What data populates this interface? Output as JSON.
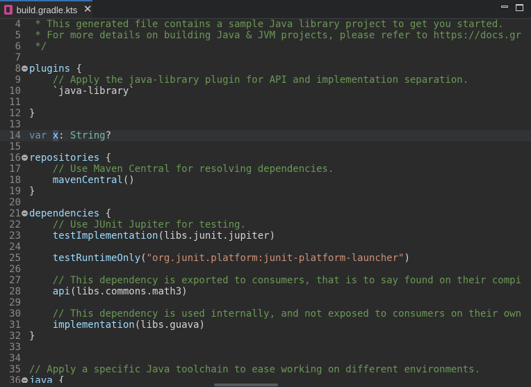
{
  "tab": {
    "title": "build.gradle.kts",
    "close_glyph": "✕"
  },
  "icons": {
    "file": "kotlin-file-icon",
    "close": "close-icon",
    "minimize": "minimize-icon",
    "maximize": "maximize-icon",
    "fold": "fold-collapse-icon"
  },
  "colors": {
    "background": "#2b2b2b",
    "comment": "#6a9955",
    "keyword": "#6897bb",
    "string": "#ce9178",
    "tab_accent": "#3a6fb0"
  },
  "current_line": 14,
  "lines": [
    {
      "n": 4,
      "fold": false,
      "tokens": [
        {
          "t": " * This generated file contains a sample Java library project to get you started.",
          "c": "comment"
        }
      ]
    },
    {
      "n": 5,
      "fold": false,
      "tokens": [
        {
          "t": " * For more details on building Java & JVM projects, please refer to https://docs.gr",
          "c": "comment"
        }
      ]
    },
    {
      "n": 6,
      "fold": false,
      "tokens": [
        {
          "t": " */",
          "c": "comment"
        }
      ]
    },
    {
      "n": 7,
      "fold": false,
      "tokens": []
    },
    {
      "n": 8,
      "fold": true,
      "tokens": [
        {
          "t": "plugins",
          "c": "fn"
        },
        {
          "t": " {",
          "c": "plain"
        }
      ]
    },
    {
      "n": 9,
      "fold": false,
      "tokens": [
        {
          "t": "    // Apply the java-library plugin for API and implementation separation.",
          "c": "comment"
        }
      ]
    },
    {
      "n": 10,
      "fold": false,
      "tokens": [
        {
          "t": "    `java-library`",
          "c": "plain"
        }
      ]
    },
    {
      "n": 11,
      "fold": false,
      "tokens": []
    },
    {
      "n": 12,
      "fold": false,
      "tokens": [
        {
          "t": "}",
          "c": "plain"
        }
      ]
    },
    {
      "n": 13,
      "fold": false,
      "tokens": []
    },
    {
      "n": 14,
      "fold": false,
      "tokens": [
        {
          "t": "var",
          "c": "kw"
        },
        {
          "t": " ",
          "c": "plain"
        },
        {
          "t": "x",
          "c": "var"
        },
        {
          "t": ": ",
          "c": "plain"
        },
        {
          "t": "String",
          "c": "type"
        },
        {
          "t": "?",
          "c": "plain"
        }
      ]
    },
    {
      "n": 15,
      "fold": false,
      "tokens": []
    },
    {
      "n": 16,
      "fold": true,
      "tokens": [
        {
          "t": "repositories",
          "c": "fn"
        },
        {
          "t": " {",
          "c": "plain"
        }
      ]
    },
    {
      "n": 17,
      "fold": false,
      "tokens": [
        {
          "t": "    // Use Maven Central for resolving dependencies.",
          "c": "comment"
        }
      ]
    },
    {
      "n": 18,
      "fold": false,
      "tokens": [
        {
          "t": "    ",
          "c": "plain"
        },
        {
          "t": "mavenCentral",
          "c": "fn"
        },
        {
          "t": "()",
          "c": "plain"
        }
      ]
    },
    {
      "n": 19,
      "fold": false,
      "tokens": [
        {
          "t": "}",
          "c": "plain"
        }
      ]
    },
    {
      "n": 20,
      "fold": false,
      "tokens": []
    },
    {
      "n": 21,
      "fold": true,
      "tokens": [
        {
          "t": "dependencies",
          "c": "fn"
        },
        {
          "t": " {",
          "c": "plain"
        }
      ]
    },
    {
      "n": 22,
      "fold": false,
      "tokens": [
        {
          "t": "    // Use JUnit Jupiter for testing.",
          "c": "comment"
        }
      ]
    },
    {
      "n": 23,
      "fold": false,
      "tokens": [
        {
          "t": "    ",
          "c": "plain"
        },
        {
          "t": "testImplementation",
          "c": "fn"
        },
        {
          "t": "(libs.junit.jupiter)",
          "c": "plain"
        }
      ]
    },
    {
      "n": 24,
      "fold": false,
      "tokens": []
    },
    {
      "n": 25,
      "fold": false,
      "tokens": [
        {
          "t": "    ",
          "c": "plain"
        },
        {
          "t": "testRuntimeOnly",
          "c": "fn"
        },
        {
          "t": "(",
          "c": "plain"
        },
        {
          "t": "\"org.junit.platform:junit-platform-launcher\"",
          "c": "str"
        },
        {
          "t": ")",
          "c": "plain"
        }
      ]
    },
    {
      "n": 26,
      "fold": false,
      "tokens": []
    },
    {
      "n": 27,
      "fold": false,
      "tokens": [
        {
          "t": "    // This dependency is exported to consumers, that is to say found on their compi",
          "c": "comment"
        }
      ]
    },
    {
      "n": 28,
      "fold": false,
      "tokens": [
        {
          "t": "    ",
          "c": "plain"
        },
        {
          "t": "api",
          "c": "fn"
        },
        {
          "t": "(libs.commons.math3)",
          "c": "plain"
        }
      ]
    },
    {
      "n": 29,
      "fold": false,
      "tokens": []
    },
    {
      "n": 30,
      "fold": false,
      "tokens": [
        {
          "t": "    // This dependency is used internally, and not exposed to consumers on their own",
          "c": "comment"
        }
      ]
    },
    {
      "n": 31,
      "fold": false,
      "tokens": [
        {
          "t": "    ",
          "c": "plain"
        },
        {
          "t": "implementation",
          "c": "fn"
        },
        {
          "t": "(libs.guava)",
          "c": "plain"
        }
      ]
    },
    {
      "n": 32,
      "fold": false,
      "tokens": [
        {
          "t": "}",
          "c": "plain"
        }
      ]
    },
    {
      "n": 33,
      "fold": false,
      "tokens": []
    },
    {
      "n": 34,
      "fold": false,
      "tokens": []
    },
    {
      "n": 35,
      "fold": false,
      "tokens": [
        {
          "t": "// Apply a specific Java toolchain to ease working on different environments.",
          "c": "comment"
        }
      ]
    },
    {
      "n": 36,
      "fold": true,
      "tokens": [
        {
          "t": "java",
          "c": "fn"
        },
        {
          "t": " {",
          "c": "plain"
        }
      ]
    }
  ]
}
